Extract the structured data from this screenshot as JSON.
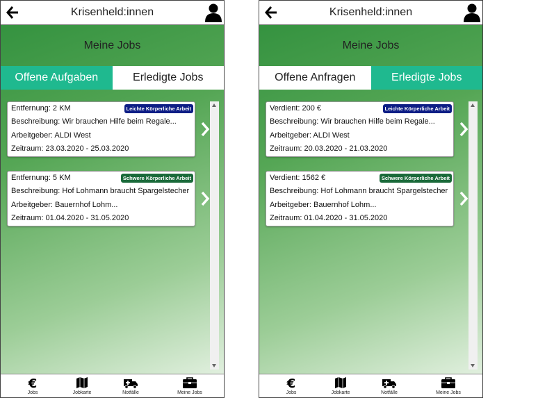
{
  "app_title": "Krisenheld:innen",
  "section_title": "Meine Jobs",
  "left": {
    "tabs": [
      {
        "label": "Offene Aufgaben"
      },
      {
        "label": "Erledigte Jobs"
      }
    ],
    "cards": [
      {
        "line1": "Entfernung: 2 KM",
        "badge": "Leichte Körperliche Arbeit",
        "line2": "Beschreibung: Wir brauchen Hilfe beim Regale...",
        "line3": "Arbeitgeber: ALDI West",
        "line4": "Zeitraum: 23.03.2020 - 25.03.2020"
      },
      {
        "line1": "Entfernung: 5 KM",
        "badge": "Schwere Körperliche Arbeit",
        "line2": "Beschreibung: Hof Lohmann braucht Spargelstecher",
        "line3": "Arbeitgeber: Bauernhof Lohm...",
        "line4": "Zeitraum: 01.04.2020 - 31.05.2020"
      }
    ]
  },
  "right": {
    "tabs": [
      {
        "label": "Offene Anfragen"
      },
      {
        "label": "Erledigte Jobs"
      }
    ],
    "cards": [
      {
        "line1": "Verdient: 200 €",
        "badge": "Leichte Körperliche Arbeit",
        "line2": "Beschreibung: Wir brauchen Hilfe beim Regale...",
        "line3": "Arbeitgeber: ALDI West",
        "line4": "Zeitraum: 20.03.2020 - 21.03.2020"
      },
      {
        "line1": "Verdient: 1562 €",
        "badge": "Schwere Körperliche Arbeit",
        "line2": "Beschreibung: Hof Lohmann braucht Spargelstecher",
        "line3": "Arbeitgeber: Bauernhof Lohm...",
        "line4": "Zeitraum: 01.04.2020 - 31.05.2020"
      }
    ]
  },
  "nav": [
    {
      "label": "Jobs",
      "icon": "euro-icon"
    },
    {
      "label": "Jobkarte",
      "icon": "map-icon"
    },
    {
      "label": "Notfälle",
      "icon": "ambulance-icon"
    },
    {
      "label": "Meine Jobs",
      "icon": "briefcase-icon"
    }
  ],
  "colors": {
    "active_tab": "#1fb98f",
    "badge_light": "#0d1d85",
    "badge_heavy": "#1a6a3a",
    "header_green": "#2f8f3c"
  }
}
